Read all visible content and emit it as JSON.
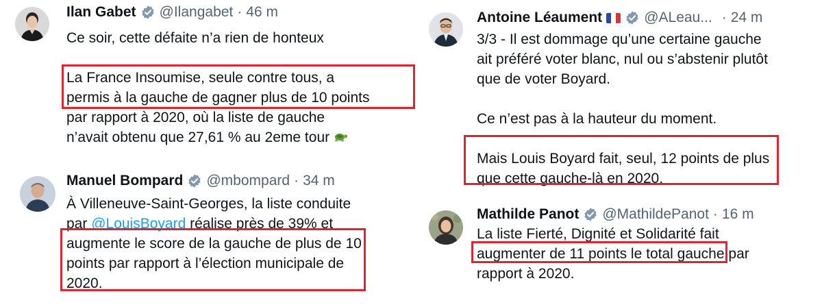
{
  "tweets": [
    {
      "name": "Ilan Gabet",
      "handle": "@Ilangabet",
      "time": "46 m",
      "lines": [
        "Ce soir, cette défaite n’a rien de honteux",
        "",
        "La France Insoumise, seule contre tous, a",
        "permis à la gauche de gagner plus de 10 points",
        "par rapport à 2020, où la liste de gauche",
        "n’avait obtenu que 27,61 % au 2eme tour"
      ],
      "emoji": "turtle-emoji"
    },
    {
      "name": "Manuel Bompard",
      "handle": "@mbompard",
      "time": "34 m",
      "lines": [
        "À Villeneuve-Saint-Georges, la liste conduite",
        "réalise près de 39% et",
        "augmente le score de la gauche de plus de 10",
        "points par rapport à l’élection municipale de",
        "2020."
      ],
      "line2_prefix": "par",
      "mention": "@LouisBoyard"
    },
    {
      "name": "Antoine Léaument",
      "handle": "@ALeau...",
      "time": "24 m",
      "lines": [
        "3/3 - Il est dommage qu’une certaine gauche",
        "ait préféré voter blanc, nul ou s’abstenir plutôt",
        "que de voter Boyard.",
        "",
        "Ce n’est pas à la hauteur du moment.",
        "",
        "Mais Louis Boyard fait, seul, 12 points de plus",
        "que cette gauche-là en 2020."
      ]
    },
    {
      "name": "Mathilde Panot",
      "handle": "@MathildePanot",
      "time": "16 m",
      "lines": [
        "La liste Fierté, Dignité et Solidarité fait",
        "augmenter de 11 points le total gauche",
        "rapport à 2020."
      ],
      "line2_suffix": "par"
    }
  ],
  "separator": "·",
  "colors": {
    "text": "#0f1419",
    "muted": "#536471",
    "link": "#1d9bf0",
    "verified": "#829aab",
    "highlight": "#d9262f"
  }
}
